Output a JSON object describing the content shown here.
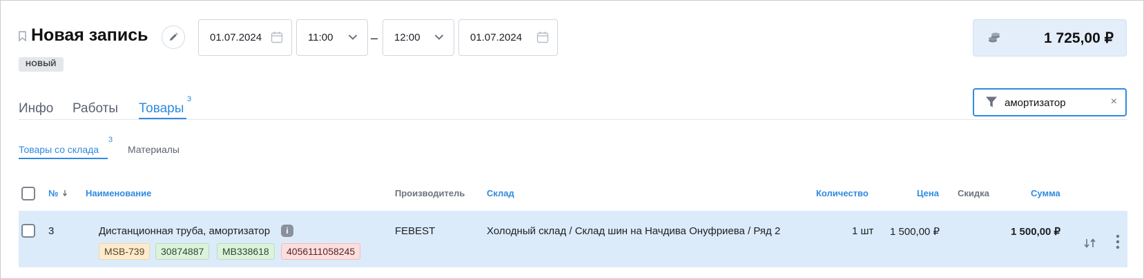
{
  "header": {
    "title": "Новая запись",
    "status_badge": "НОВЫЙ",
    "date_start": "01.07.2024",
    "time_start": "11:00",
    "separator": "–",
    "time_end": "12:00",
    "date_end": "01.07.2024",
    "total": "1 725,00 ₽"
  },
  "tabs": [
    {
      "label": "Инфо",
      "count": ""
    },
    {
      "label": "Работы",
      "count": ""
    },
    {
      "label": "Товары",
      "count": "3",
      "active": true
    }
  ],
  "filter": {
    "value": "амортизатор",
    "clear": "×"
  },
  "subtabs": [
    {
      "label": "Товары со склада",
      "count": "3",
      "active": true
    },
    {
      "label": "Материалы",
      "count": ""
    }
  ],
  "table": {
    "columns": {
      "number": "№",
      "name": "Наименование",
      "manufacturer": "Производитель",
      "warehouse": "Склад",
      "quantity": "Количество",
      "price": "Цена",
      "discount": "Скидка",
      "sum": "Сумма"
    },
    "rows": [
      {
        "number": "3",
        "name": "Дистанционная труба, амортизатор",
        "info": "i",
        "manufacturer": "FEBEST",
        "warehouse": "Холодный склад / Склад шин на Начдива Онуфриева / Ряд 2",
        "quantity": "1 шт",
        "price": "1 500,00 ₽",
        "discount": "",
        "sum": "1 500,00 ₽",
        "tags": [
          {
            "text": "MSB-739",
            "color": "#fcebcf"
          },
          {
            "text": "30874887",
            "color": "#dcf2dc"
          },
          {
            "text": "MB338618",
            "color": "#dcf2dc"
          },
          {
            "text": "4056111058245",
            "color": "#fbdede"
          }
        ]
      }
    ]
  },
  "colors": {
    "accent": "#2f8ae0",
    "row_selected": "#dcebfa",
    "total_bg": "#e3eefa"
  }
}
